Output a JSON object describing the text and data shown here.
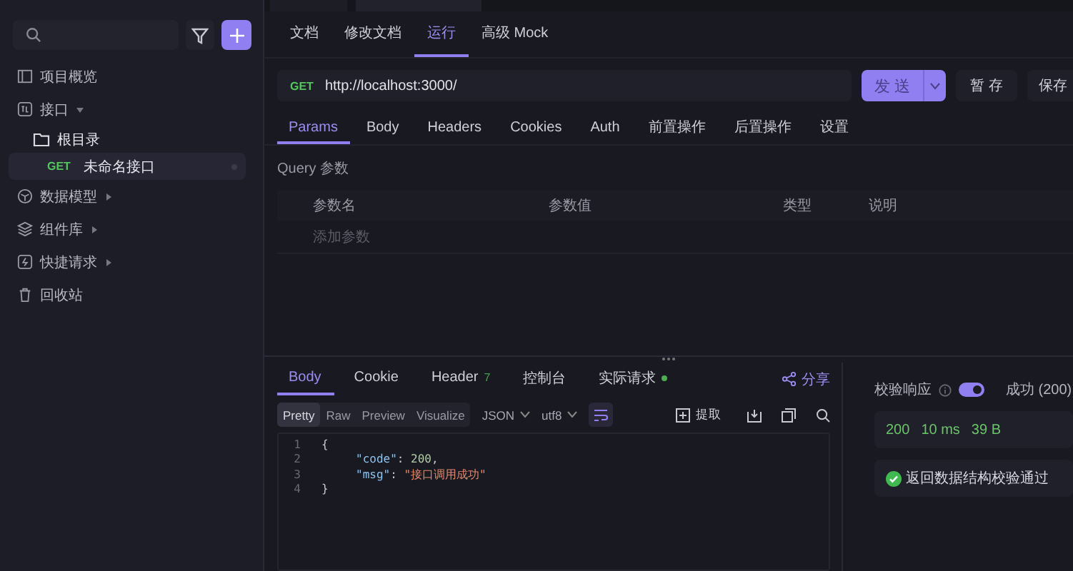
{
  "sidebar": {
    "items": [
      {
        "kind": "nav",
        "label": "项目概览",
        "selected": false
      },
      {
        "kind": "nav",
        "label": "接口",
        "selected": false,
        "expanded": true,
        "children": [
          {
            "kind": "folder",
            "label": "根目录",
            "selected": false,
            "children": [
              {
                "kind": "endpoint",
                "method": "GET",
                "label": "未命名接口",
                "selected": true
              }
            ]
          }
        ]
      },
      {
        "kind": "nav",
        "label": "数据模型",
        "selected": false,
        "expanded": false
      },
      {
        "kind": "nav",
        "label": "组件库",
        "selected": false,
        "expanded": false
      },
      {
        "kind": "nav",
        "label": "快捷请求",
        "selected": false,
        "expanded": false
      },
      {
        "kind": "nav",
        "label": "回收站",
        "selected": false
      }
    ]
  },
  "doc_tabs": [
    {
      "label": "文档",
      "selected": false
    },
    {
      "label": "修改文档",
      "selected": false
    },
    {
      "label": "运行",
      "selected": true
    },
    {
      "label": "高级 Mock",
      "selected": false
    }
  ],
  "request": {
    "method": "GET",
    "url": "http://localhost:3000/",
    "send": "发 送",
    "stash": "暂 存",
    "save": "保存"
  },
  "param_tabs": [
    {
      "label": "Params",
      "selected": true
    },
    {
      "label": "Body",
      "selected": false
    },
    {
      "label": "Headers",
      "selected": false
    },
    {
      "label": "Cookies",
      "selected": false
    },
    {
      "label": "Auth",
      "selected": false
    },
    {
      "label": "前置操作",
      "selected": false
    },
    {
      "label": "后置操作",
      "selected": false
    },
    {
      "label": "设置",
      "selected": false
    }
  ],
  "query": {
    "title": "Query 参数",
    "columns": [
      "参数名",
      "参数值",
      "类型",
      "说明"
    ],
    "add_placeholder": "添加参数"
  },
  "response_tabs": [
    {
      "label": "Body",
      "selected": true
    },
    {
      "label": "Cookie",
      "selected": false
    },
    {
      "label": "Header",
      "badge": "7",
      "selected": false
    },
    {
      "label": "控制台",
      "selected": false
    },
    {
      "label": "实际请求",
      "live": true,
      "selected": false
    }
  ],
  "share": "分享",
  "view_modes": [
    {
      "label": "Pretty",
      "selected": true
    },
    {
      "label": "Raw",
      "selected": false
    },
    {
      "label": "Preview",
      "selected": false
    },
    {
      "label": "Visualize",
      "selected": false
    }
  ],
  "format": "JSON",
  "encoding": "utf8",
  "wrap_on": true,
  "extract": "提取",
  "code": [
    {
      "no": "1",
      "indent": false,
      "tokens": [
        {
          "kind": "punct",
          "text": "{"
        }
      ]
    },
    {
      "no": "2",
      "indent": true,
      "tokens": [
        {
          "kind": "key",
          "text": "\"code\""
        },
        {
          "kind": "punct",
          "text": ": "
        },
        {
          "kind": "number",
          "text": "200"
        },
        {
          "kind": "punct",
          "text": ","
        }
      ]
    },
    {
      "no": "3",
      "indent": true,
      "tokens": [
        {
          "kind": "key",
          "text": "\"msg\""
        },
        {
          "kind": "punct",
          "text": ": "
        },
        {
          "kind": "string",
          "text": "\"接口调用成功\""
        }
      ]
    },
    {
      "no": "4",
      "indent": false,
      "tokens": [
        {
          "kind": "punct",
          "text": "}"
        }
      ]
    }
  ],
  "validation": {
    "label": "校验响应",
    "on": true,
    "result": "成功 (200)",
    "stats": [
      "200",
      "10 ms",
      "39 B"
    ],
    "message": "返回数据结构校验通过",
    "passed": true
  }
}
